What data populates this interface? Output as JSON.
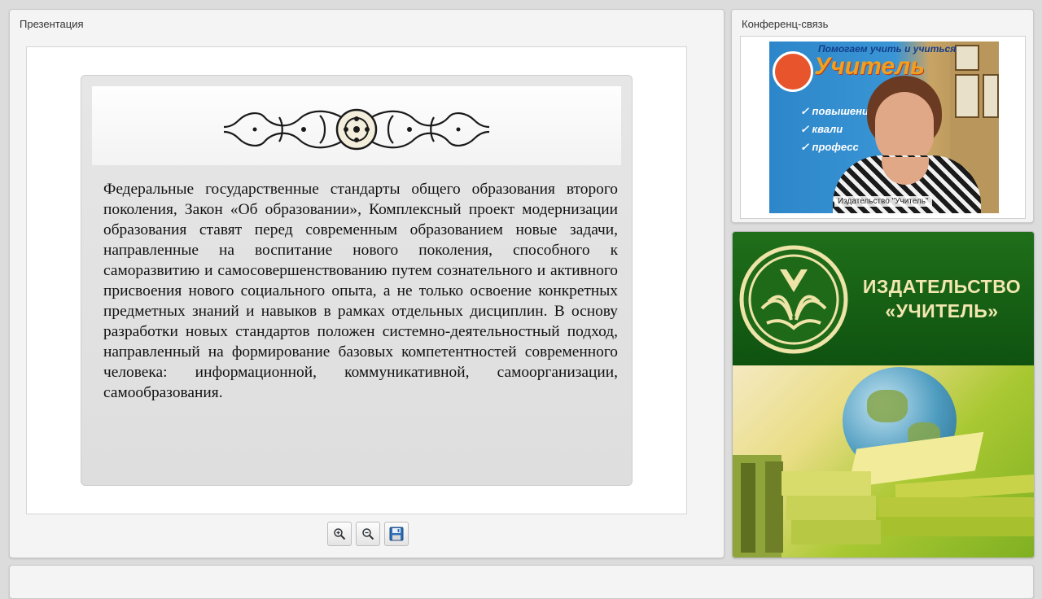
{
  "presentation": {
    "title": "Презентация",
    "slide_text": "Федеральные государственные стандарты общего образования второго поколения, Закон «Об образовании», Комплексный проект модернизации образования ставят перед современным образованием новые задачи, направленные на воспитание нового поколения, способного к саморазвитию и самосовершенствованию путем сознательного и активного присвоения нового социального опыта, а не только освоение конкретных предметных знаний и навыков в рамках отдельных дисциплин. В основу разработки новых стандартов положен системно-деятельностный подход, направленный на формирование базовых компетентностей современного человека: информационной, коммуникативной, самоорганизации, самообразования.",
    "toolbar": [
      {
        "icon": "zoom-in-icon"
      },
      {
        "icon": "zoom-out-icon"
      },
      {
        "icon": "save-icon"
      }
    ]
  },
  "conference": {
    "title": "Конференц-связь",
    "video": {
      "banner_top": "Помогаем учить и учиться",
      "banner_word": "Учитель",
      "banner_lines": [
        "✓ повышени",
        "✓ квали",
        "✓ професс"
      ],
      "caption": "Издательство \"Учитель\""
    }
  },
  "publisher": {
    "name_line1": "ИЗДАТЕЛЬСТВО",
    "name_line2": "«УЧИТЕЛЬ»"
  },
  "colors": {
    "banner_green": "#1a6516",
    "banner_text": "#f2e7b0",
    "video_blue": "#2c86c9"
  }
}
